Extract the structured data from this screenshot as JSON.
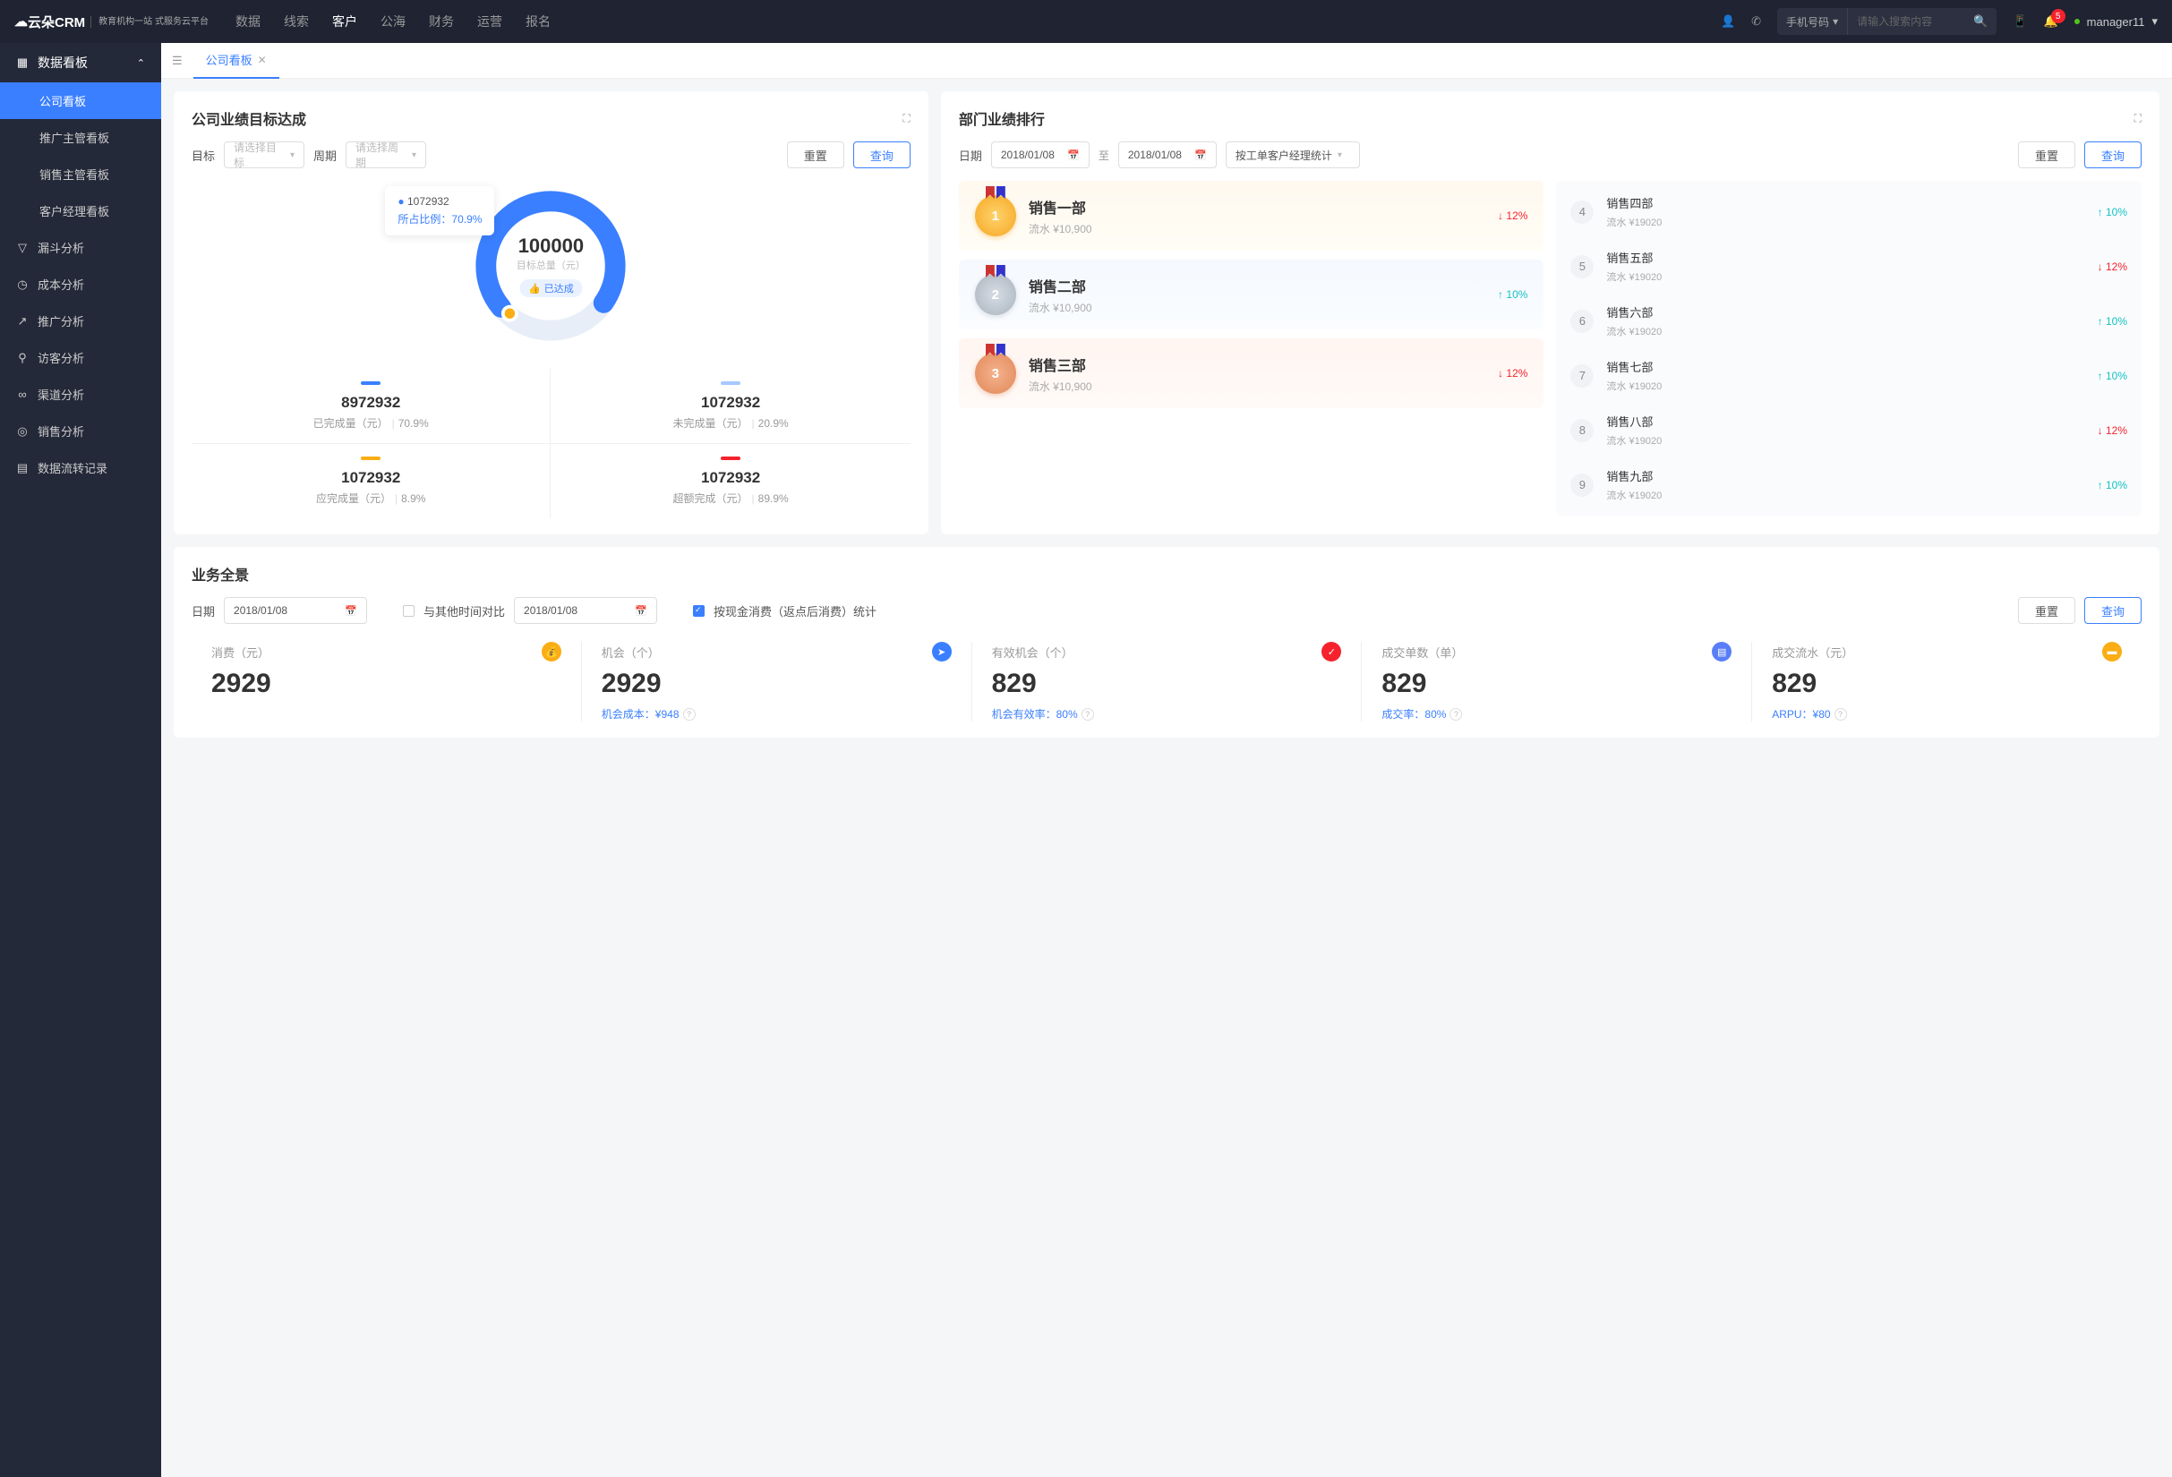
{
  "header": {
    "logo": "云朵CRM",
    "logo_sub": "教育机构一站\n式服务云平台",
    "nav": [
      "数据",
      "线索",
      "客户",
      "公海",
      "财务",
      "运营",
      "报名"
    ],
    "nav_active": 2,
    "search_type": "手机号码",
    "search_placeholder": "请输入搜索内容",
    "notif_count": "5",
    "user": "manager11"
  },
  "sidebar": {
    "group": "数据看板",
    "children": [
      "公司看板",
      "推广主管看板",
      "销售主管看板",
      "客户经理看板"
    ],
    "active_child": 0,
    "items": [
      "漏斗分析",
      "成本分析",
      "推广分析",
      "访客分析",
      "渠道分析",
      "销售分析",
      "数据流转记录"
    ]
  },
  "tab": {
    "name": "公司看板"
  },
  "goal": {
    "title": "公司业绩目标达成",
    "lbl_target": "目标",
    "sel_target": "请选择目标",
    "lbl_period": "周期",
    "sel_period": "请选择周期",
    "reset": "重置",
    "query": "查询",
    "total": "100000",
    "total_lbl": "目标总量（元）",
    "tag": "已达成",
    "tooltip_v": "1072932",
    "tooltip_l": "所占比例：",
    "tooltip_r": "70.9%",
    "stats": [
      {
        "color": "#3a7fff",
        "v": "8972932",
        "l": "已完成量（元）",
        "p": "70.9%"
      },
      {
        "color": "#a6c8ff",
        "v": "1072932",
        "l": "未完成量（元）",
        "p": "20.9%"
      },
      {
        "color": "#faad14",
        "v": "1072932",
        "l": "应完成量（元）",
        "p": "8.9%"
      },
      {
        "color": "#f5222d",
        "v": "1072932",
        "l": "超额完成（元）",
        "p": "89.9%"
      }
    ]
  },
  "ranking": {
    "title": "部门业绩排行",
    "lbl_date": "日期",
    "date1": "2018/01/08",
    "to": "至",
    "date2": "2018/01/08",
    "stat_by": "按工单客户经理统计",
    "reset": "重置",
    "query": "查询",
    "top": [
      {
        "rank": "1",
        "name": "销售一部",
        "sub": "流水 ¥10,900",
        "pct": "12%",
        "dir": "down"
      },
      {
        "rank": "2",
        "name": "销售二部",
        "sub": "流水 ¥10,900",
        "pct": "10%",
        "dir": "up"
      },
      {
        "rank": "3",
        "name": "销售三部",
        "sub": "流水 ¥10,900",
        "pct": "12%",
        "dir": "down"
      }
    ],
    "rest": [
      {
        "rank": "4",
        "name": "销售四部",
        "sub": "流水 ¥19020",
        "pct": "10%",
        "dir": "up"
      },
      {
        "rank": "5",
        "name": "销售五部",
        "sub": "流水 ¥19020",
        "pct": "12%",
        "dir": "down"
      },
      {
        "rank": "6",
        "name": "销售六部",
        "sub": "流水 ¥19020",
        "pct": "10%",
        "dir": "up"
      },
      {
        "rank": "7",
        "name": "销售七部",
        "sub": "流水 ¥19020",
        "pct": "10%",
        "dir": "up"
      },
      {
        "rank": "8",
        "name": "销售八部",
        "sub": "流水 ¥19020",
        "pct": "12%",
        "dir": "down"
      },
      {
        "rank": "9",
        "name": "销售九部",
        "sub": "流水 ¥19020",
        "pct": "10%",
        "dir": "up"
      }
    ]
  },
  "overview": {
    "title": "业务全景",
    "lbl_date": "日期",
    "date": "2018/01/08",
    "compare": "与其他时间对比",
    "date2": "2018/01/08",
    "opt": "按现金消费（返点后消费）统计",
    "reset": "重置",
    "query": "查询",
    "kpis": [
      {
        "label": "消费（元）",
        "value": "2929",
        "icon": "💰",
        "color": "#faad14",
        "foot": ""
      },
      {
        "label": "机会（个）",
        "value": "2929",
        "icon": "➤",
        "color": "#3a7fff",
        "foot": "机会成本：¥948"
      },
      {
        "label": "有效机会（个）",
        "value": "829",
        "icon": "✓",
        "color": "#f5222d",
        "foot": "机会有效率：80%"
      },
      {
        "label": "成交单数（单）",
        "value": "829",
        "icon": "▤",
        "color": "#597ef7",
        "foot": "成交率：80%"
      },
      {
        "label": "成交流水（元）",
        "value": "829",
        "icon": "▬",
        "color": "#faad14",
        "foot": "ARPU：¥80"
      }
    ]
  },
  "chart_data": {
    "type": "pie",
    "title": "公司业绩目标达成",
    "total": 100000,
    "series": [
      {
        "name": "已完成量（元）",
        "value": 8972932,
        "pct": 70.9,
        "color": "#3a7fff"
      },
      {
        "name": "未完成量（元）",
        "value": 1072932,
        "pct": 20.9,
        "color": "#a6c8ff"
      },
      {
        "name": "应完成量（元）",
        "value": 1072932,
        "pct": 8.9,
        "color": "#faad14"
      },
      {
        "name": "超额完成（元）",
        "value": 1072932,
        "pct": 89.9,
        "color": "#f5222d"
      }
    ]
  }
}
